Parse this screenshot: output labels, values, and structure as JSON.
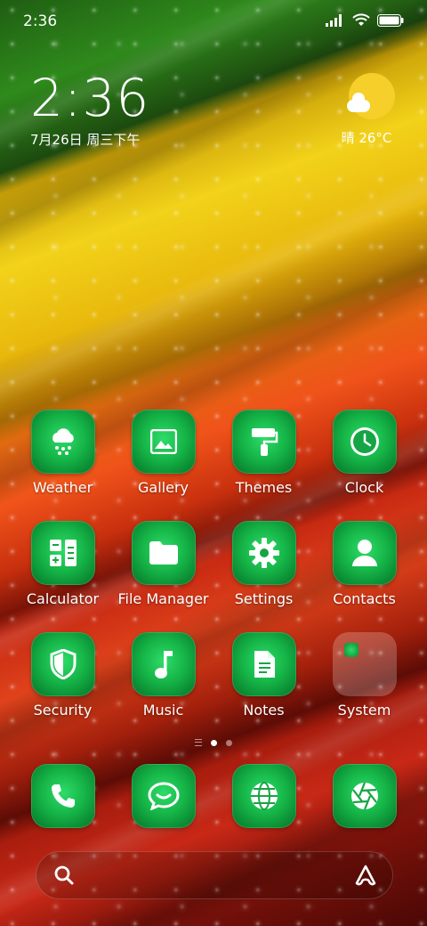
{
  "status_bar": {
    "time": "2:36",
    "icons": [
      "signal-icon",
      "wifi-icon",
      "battery-icon"
    ]
  },
  "clock_widget": {
    "time": "2:36",
    "date": "7月26日 周三下午"
  },
  "weather_widget": {
    "text": "晴 26°C",
    "icon": "partly-sunny-icon"
  },
  "apps": [
    {
      "label": "Weather",
      "icon": "weather-snow-cloud-icon"
    },
    {
      "label": "Gallery",
      "icon": "image-icon"
    },
    {
      "label": "Themes",
      "icon": "paint-roller-icon"
    },
    {
      "label": "Clock",
      "icon": "clock-icon"
    },
    {
      "label": "Calculator",
      "icon": "calculator-icon"
    },
    {
      "label": "File Manager",
      "icon": "folder-icon"
    },
    {
      "label": "Settings",
      "icon": "gear-icon"
    },
    {
      "label": "Contacts",
      "icon": "person-icon"
    },
    {
      "label": "Security",
      "icon": "shield-icon"
    },
    {
      "label": "Music",
      "icon": "music-note-icon"
    },
    {
      "label": "Notes",
      "icon": "document-icon"
    },
    {
      "label": "System",
      "icon": "folder-group-icon"
    }
  ],
  "page_indicator": {
    "pages": 2,
    "active": 1
  },
  "dock": [
    {
      "icon": "phone-icon"
    },
    {
      "icon": "message-icon"
    },
    {
      "icon": "globe-icon"
    },
    {
      "icon": "camera-aperture-icon"
    }
  ],
  "search_bar": {
    "left_icon": "search-icon",
    "right_icon": "assistant-icon"
  },
  "colors": {
    "icon_green": "#16b548",
    "accent_yellow": "#f6cf2a"
  }
}
